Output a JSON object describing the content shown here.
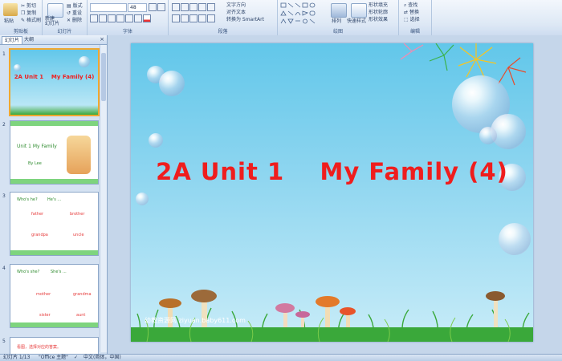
{
  "ribbon": {
    "clipboard": {
      "paste": "粘贴",
      "cut": "剪切",
      "copy": "复制",
      "format_painter": "格式刷",
      "group": "剪贴板"
    },
    "slides": {
      "new_slide": "新建\n幻灯片",
      "layout": "版式",
      "reset": "重设",
      "delete": "删除",
      "group": "幻灯片"
    },
    "font": {
      "size": "48",
      "group": "字体"
    },
    "paragraph": {
      "text_direction": "文字方向",
      "align_text": "对齐文本",
      "convert_smartart": "转换为 SmartArt",
      "group": "段落"
    },
    "drawing": {
      "arrange": "排列",
      "quick_styles": "快速样式",
      "shape_fill": "形状填充",
      "shape_outline": "形状轮廓",
      "shape_effects": "形状效果",
      "group": "绘图"
    },
    "editing": {
      "find": "查找",
      "replace": "替换",
      "select": "选择",
      "group": "编辑"
    }
  },
  "pane": {
    "tab_slides": "幻灯片",
    "tab_outline": "大纲",
    "close": "×"
  },
  "thumbnails": [
    {
      "num": "1",
      "title": "2A Unit 1    My Family (4)"
    },
    {
      "num": "2",
      "title": "Unit 1 My Family",
      "sub": "By Lee"
    },
    {
      "num": "3",
      "q": "Who's he?",
      "a": "He's ...",
      "words": [
        "father",
        "brother",
        "grandpa",
        "uncle"
      ]
    },
    {
      "num": "4",
      "q": "Who's she?",
      "a": "She's ...",
      "words": [
        "mother",
        "grandma",
        "sister",
        "aunt"
      ]
    },
    {
      "num": "5",
      "text": "看图，选择对应的答案。"
    }
  ],
  "slide": {
    "title": "2A Unit 1    My Family (4)",
    "watermark": "幼教资源网 ziyuan.baby611.com"
  },
  "status": {
    "slide_info": "幻灯片 1/13",
    "theme": "\"Office 主题\"",
    "language": "中文(简体，中国)"
  },
  "colors": {
    "title_red": "#ef1d1d",
    "sky_top": "#62c7ea",
    "sky_bottom": "#c8ecf8",
    "grass": "#3aa83a",
    "selected_border": "#f0a830"
  }
}
